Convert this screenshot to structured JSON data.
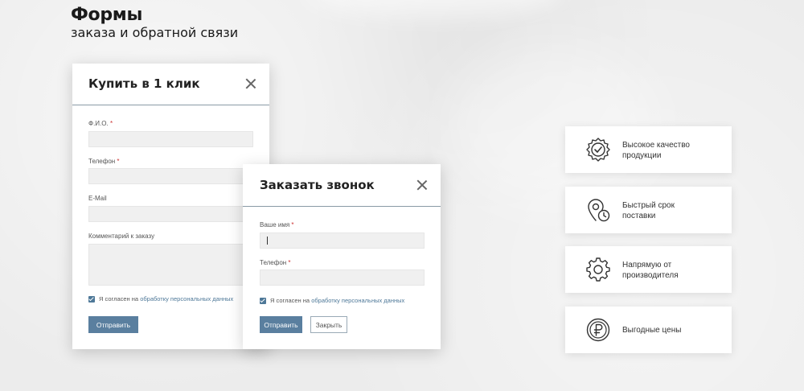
{
  "header": {
    "title": "Формы",
    "subtitle": "заказа и обратной связи"
  },
  "buy_modal": {
    "title": "Купить в 1 клик",
    "fields": [
      {
        "label": "Ф.И.О.",
        "required": "*",
        "value": "",
        "placeholder": ""
      },
      {
        "label": "Телефон",
        "required": "*",
        "value": "",
        "placeholder": ""
      },
      {
        "label": "E-Mail",
        "required": "",
        "value": "",
        "placeholder": ""
      },
      {
        "label": "Комментарий к заказу",
        "required": "",
        "value": "",
        "placeholder": ""
      }
    ],
    "consent_prefix": "Я согласен на",
    "consent_link": "обработку персональных данных",
    "submit_label": "Отправить",
    "consent_checked": true
  },
  "call_modal": {
    "title": "Заказать звонок",
    "fields": [
      {
        "label": "Ваше имя",
        "required": "*",
        "value": "",
        "placeholder": ""
      },
      {
        "label": "Телефон",
        "required": "*",
        "value": "",
        "placeholder": ""
      }
    ],
    "consent_prefix": "Я согласен на",
    "consent_link": "обработку персональных данных",
    "submit_label": "Отправить",
    "close_label": "Закрыть",
    "consent_checked": true
  },
  "features": [
    {
      "icon": "quality-badge-icon",
      "line1": "Высокое качество",
      "line2": "продукции"
    },
    {
      "icon": "location-clock-icon",
      "line1": "Быстрый срок",
      "line2": "поставки"
    },
    {
      "icon": "gear-icon",
      "line1": "Напрямую от",
      "line2": "производителя"
    },
    {
      "icon": "ruble-coin-icon",
      "line1": "Выгодные цены",
      "line2": ""
    }
  ],
  "colors": {
    "accent": "#4e7898",
    "button": "#5a7f9f",
    "required": "#cc3333",
    "background": "#ececec"
  }
}
